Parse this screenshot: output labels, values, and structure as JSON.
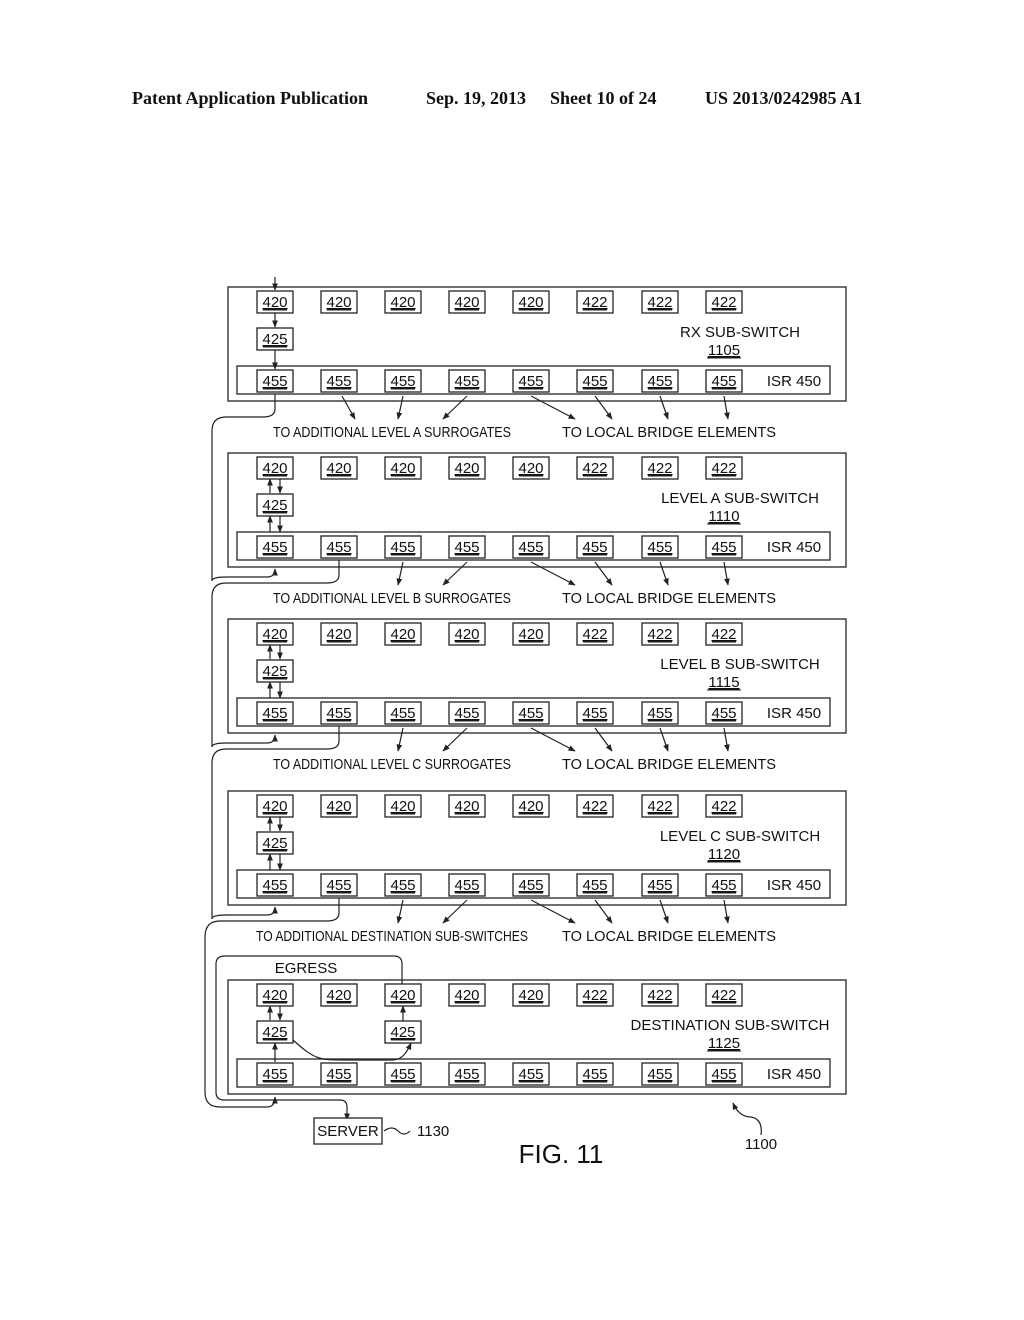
{
  "header": {
    "publication": "Patent Application Publication",
    "date": "Sep. 19, 2013",
    "sheet": "Sheet 10 of 24",
    "number": "US 2013/0242985 A1"
  },
  "figure": {
    "label": "FIG. 11",
    "ref": "1100",
    "server": {
      "label": "SERVER",
      "ref": "1130"
    },
    "egress_label": "EGRESS",
    "isr_label": "ISR 450",
    "top_row": [
      "420",
      "420",
      "420",
      "420",
      "420",
      "422",
      "422",
      "422"
    ],
    "bottom_row": [
      "455",
      "455",
      "455",
      "455",
      "455",
      "455",
      "455",
      "455"
    ],
    "surrogate_box": "425",
    "sub_switches": [
      {
        "name": "RX  SUB-SWITCH",
        "ref": "1105",
        "left_note": "TO ADDITIONAL LEVEL  A  SURROGATES",
        "right_note": "TO LOCAL BRIDGE ELEMENTS"
      },
      {
        "name": "LEVEL  A  SUB-SWITCH",
        "ref": "1110",
        "left_note": "TO ADDITIONAL LEVEL  B  SURROGATES",
        "right_note": "TO LOCAL BRIDGE ELEMENTS"
      },
      {
        "name": "LEVEL  B  SUB-SWITCH",
        "ref": "1115",
        "left_note": "TO ADDITIONAL LEVEL  C  SURROGATES",
        "right_note": "TO LOCAL BRIDGE ELEMENTS"
      },
      {
        "name": "LEVEL  C  SUB-SWITCH",
        "ref": "1120",
        "left_note": "TO ADDITIONAL DESTINATION SUB-SWITCHES",
        "right_note": "TO LOCAL BRIDGE ELEMENTS"
      },
      {
        "name": "DESTINATION  SUB-SWITCH",
        "ref": "1125",
        "left_note": "",
        "right_note": ""
      }
    ]
  }
}
